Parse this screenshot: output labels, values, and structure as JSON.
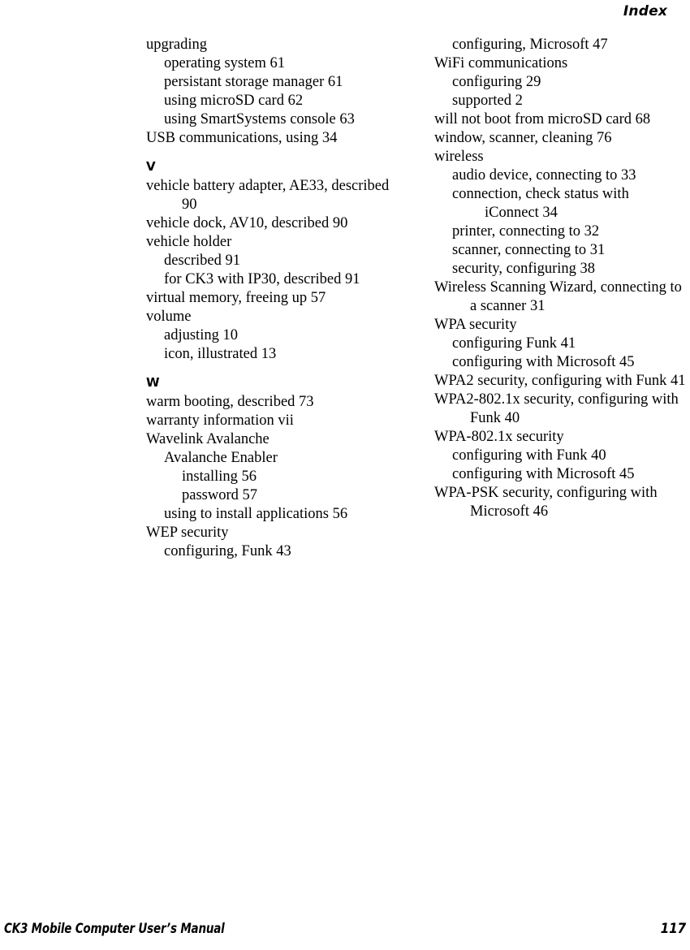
{
  "running_head": "Index",
  "footer": {
    "manual_title": "CK3 Mobile Computer User’s Manual",
    "page_number": "117"
  },
  "columns": {
    "left": [
      {
        "letter": "",
        "entries": [
          {
            "level": 0,
            "text": "upgrading"
          },
          {
            "level": 1,
            "text": "operating system 61"
          },
          {
            "level": 1,
            "text": "persistant storage manager 61"
          },
          {
            "level": 1,
            "text": "using microSD card 62"
          },
          {
            "level": 1,
            "text": "using SmartSystems console 63"
          },
          {
            "level": 0,
            "text": "USB communications, using 34"
          }
        ]
      },
      {
        "letter": "V",
        "entries": [
          {
            "level": 0,
            "text": "vehicle battery adapter, AE33, described 90",
            "wraps": true
          },
          {
            "level": 0,
            "text": "vehicle dock, AV10, described 90"
          },
          {
            "level": 0,
            "text": "vehicle holder"
          },
          {
            "level": 1,
            "text": "described 91"
          },
          {
            "level": 1,
            "text": "for CK3 with IP30, described 91"
          },
          {
            "level": 0,
            "text": "virtual memory, freeing up 57"
          },
          {
            "level": 0,
            "text": "volume"
          },
          {
            "level": 1,
            "text": "adjusting 10"
          },
          {
            "level": 1,
            "text": "icon, illustrated 13"
          }
        ]
      },
      {
        "letter": "W",
        "entries": [
          {
            "level": 0,
            "text": "warm booting, described 73"
          },
          {
            "level": 0,
            "text": "warranty information vii"
          },
          {
            "level": 0,
            "text": "Wavelink Avalanche"
          },
          {
            "level": 1,
            "text": "Avalanche Enabler"
          },
          {
            "level": 2,
            "text": "installing 56"
          },
          {
            "level": 2,
            "text": "password 57"
          },
          {
            "level": 1,
            "text": "using to install applications 56"
          },
          {
            "level": 0,
            "text": "WEP security"
          },
          {
            "level": 1,
            "text": "configuring, Funk 43"
          }
        ]
      }
    ],
    "right": [
      {
        "letter": "",
        "entries": [
          {
            "level": 1,
            "text": "configuring, Microsoft 47"
          },
          {
            "level": 0,
            "text": "WiFi communications"
          },
          {
            "level": 1,
            "text": "configuring 29"
          },
          {
            "level": 1,
            "text": "supported 2"
          },
          {
            "level": 0,
            "text": "will not boot from microSD card 68",
            "wraps": true
          },
          {
            "level": 0,
            "text": "window, scanner, cleaning 76"
          },
          {
            "level": 0,
            "text": "wireless"
          },
          {
            "level": 1,
            "text": "audio device, connecting to 33"
          },
          {
            "level": 1,
            "text": "connection, check status with iConnect 34",
            "wraps": true
          },
          {
            "level": 1,
            "text": "printer, connecting to 32"
          },
          {
            "level": 1,
            "text": "scanner, connecting to 31"
          },
          {
            "level": 1,
            "text": "security, configuring 38"
          },
          {
            "level": 0,
            "text": "Wireless Scanning Wizard, connecting to a scanner 31",
            "wraps": true
          },
          {
            "level": 0,
            "text": "WPA security"
          },
          {
            "level": 1,
            "text": "configuring Funk 41"
          },
          {
            "level": 1,
            "text": "configuring with Microsoft 45"
          },
          {
            "level": 0,
            "text": "WPA2 security, configuring with Funk 41",
            "wraps": true
          },
          {
            "level": 0,
            "text": "WPA2-802.1x security, configuring with Funk 40",
            "wraps": true
          },
          {
            "level": 0,
            "text": "WPA-802.1x security"
          },
          {
            "level": 1,
            "text": "configuring with Funk 40"
          },
          {
            "level": 1,
            "text": "configuring with Microsoft 45"
          },
          {
            "level": 0,
            "text": "WPA-PSK security, configuring with Microsoft 46",
            "wraps": true
          }
        ]
      }
    ]
  }
}
